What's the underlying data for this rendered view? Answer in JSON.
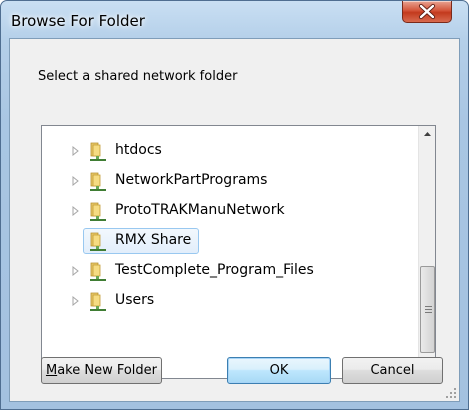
{
  "window": {
    "title": "Browse For Folder"
  },
  "dialog": {
    "prompt": "Select a shared network folder",
    "tree": {
      "items": [
        {
          "label": "htdocs",
          "expandable": true,
          "selected": false
        },
        {
          "label": "NetworkPartPrograms",
          "expandable": true,
          "selected": false
        },
        {
          "label": "ProtoTRAKManuNetwork",
          "expandable": true,
          "selected": false
        },
        {
          "label": "RMX Share",
          "expandable": false,
          "selected": true
        },
        {
          "label": "TestComplete_Program_Files",
          "expandable": true,
          "selected": false
        },
        {
          "label": "Users",
          "expandable": true,
          "selected": false
        }
      ]
    },
    "buttons": {
      "make_new_folder_mnemonic": "M",
      "make_new_folder_rest": "ake New Folder",
      "ok": "OK",
      "cancel": "Cancel"
    }
  },
  "icons": {
    "close": "close-icon",
    "folder": "network-folder-icon",
    "expander": "triangle-right-icon"
  },
  "colors": {
    "title_bar": "#b4cfe9",
    "close_button": "#c33a1d",
    "selection": "#e2eefb",
    "default_button": "#bee6fd"
  }
}
